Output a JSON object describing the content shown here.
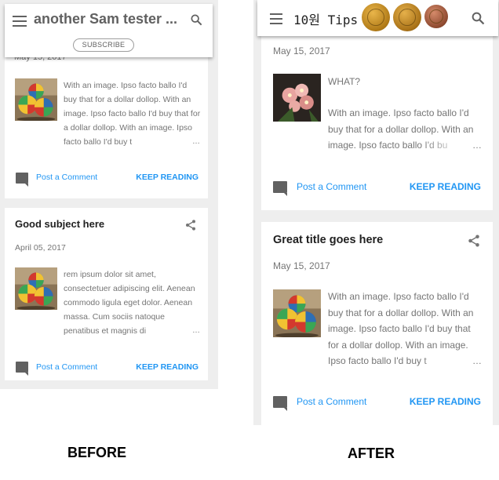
{
  "before": {
    "header": {
      "title": "another Sam tester ...",
      "subscribe_label": "SUBSCRIBE"
    },
    "post1": {
      "date_partial": "May 15, 2017",
      "snippet": "With an image. Ipso facto ballo I'd buy that for a dollar dollop. With an image. Ipso facto ballo I'd buy that for a dollar dollop. With an image. Ipso facto ballo I'd buy t",
      "ellipsis": "…",
      "comment_label": "Post a Comment",
      "keep_reading": "KEEP READING"
    },
    "post2": {
      "title": "Good subject here",
      "date": "April 05, 2017",
      "snippet": "rem ipsum dolor sit amet, consectetuer adipiscing elit. Aenean commodo ligula eget dolor. Aenean massa. Cum sociis natoque penatibus et magnis di",
      "ellipsis": "…",
      "comment_label": "Post a Comment",
      "keep_reading": "KEEP READING"
    },
    "caption": "BEFORE"
  },
  "after": {
    "header": {
      "title": "10원 Tips"
    },
    "post1": {
      "date": "May 15, 2017",
      "heading": "WHAT?",
      "snippet": "With an image. Ipso facto ballo I'd buy that for a dollar dollop. With an image. Ipso facto ballo I'd bu",
      "ellipsis": "…",
      "comment_label": "Post a Comment",
      "keep_reading": "KEEP READING"
    },
    "post2": {
      "title": "Great title goes here",
      "date": "May 15, 2017",
      "snippet": "With an image. Ipso facto ballo I'd buy that for a dollar dollop. With an image. Ipso facto ballo I'd buy that for a dollar dollop. With an image. Ipso facto ballo I'd buy t",
      "ellipsis": "…",
      "comment_label": "Post a Comment",
      "keep_reading": "KEEP READING"
    },
    "caption": "AFTER"
  },
  "icons": {
    "menu": "hamburger-menu-icon",
    "search": "search-icon",
    "share": "share-icon",
    "comment": "comment-icon"
  },
  "colors": {
    "link": "#2196f3",
    "text_muted": "#757575",
    "title": "#212121",
    "background": "#eeeeee"
  }
}
